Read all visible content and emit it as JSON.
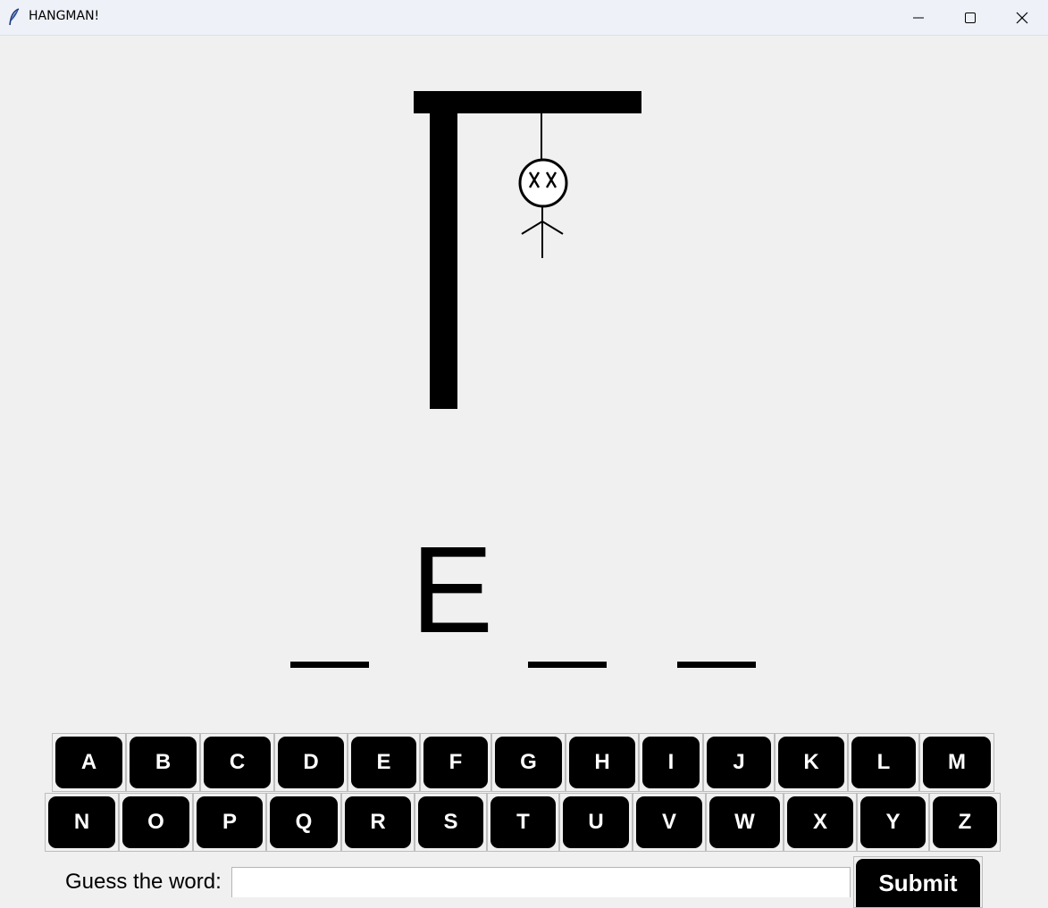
{
  "window": {
    "title": "HANGMAN!",
    "icon": "feather-icon",
    "controls": [
      "minimize-icon",
      "maximize-icon",
      "close-icon"
    ]
  },
  "gallows": {
    "parts_shown": [
      "head",
      "eyes-xx",
      "arms",
      "body"
    ]
  },
  "word": {
    "slots": [
      "_",
      "E",
      "_",
      "_"
    ]
  },
  "keyboard": {
    "row1": [
      "A",
      "B",
      "C",
      "D",
      "E",
      "F",
      "G",
      "H",
      "I",
      "J",
      "K",
      "L",
      "M"
    ],
    "row2": [
      "N",
      "O",
      "P",
      "Q",
      "R",
      "S",
      "T",
      "U",
      "V",
      "W",
      "X",
      "Y",
      "Z"
    ]
  },
  "guess": {
    "label": "Guess the word:",
    "value": "",
    "submit_label": "Submit"
  }
}
